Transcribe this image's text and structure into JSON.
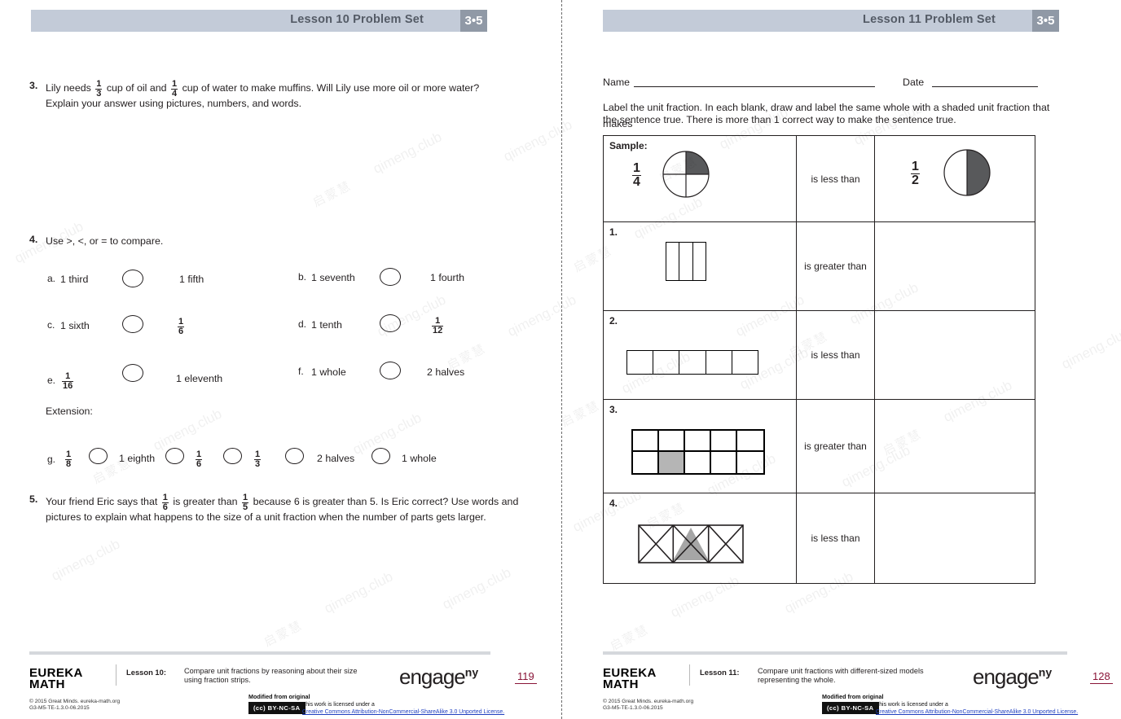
{
  "watermark": {
    "text_latin": "qimeng.club",
    "text_cjk": "启蒙慧"
  },
  "left_page": {
    "header": {
      "title": "Lesson 10 Problem Set",
      "badge": "3•5"
    },
    "problem3": {
      "number": "3.",
      "line1_a": "Lily needs",
      "frac1": {
        "n": "1",
        "d": "3"
      },
      "line1_b": "cup of oil and",
      "frac2": {
        "n": "1",
        "d": "4"
      },
      "line1_c": "cup of water to make muffins.  Will Lily use more oil or more water?",
      "line2": "Explain your answer using pictures, numbers, and words."
    },
    "problem4": {
      "number": "4.",
      "prompt": "Use >, <, or = to compare.",
      "items": [
        {
          "letter": "a.",
          "left": "1 third",
          "right": "1 fifth"
        },
        {
          "letter": "b.",
          "left": "1 seventh",
          "right": "1 fourth"
        },
        {
          "letter": "c.",
          "left": "1 sixth",
          "right_frac": {
            "n": "1",
            "d": "6"
          }
        },
        {
          "letter": "d.",
          "left": "1 tenth",
          "right_frac": {
            "n": "1",
            "d": "12"
          }
        },
        {
          "letter": "e.",
          "left_frac": {
            "n": "1",
            "d": "16"
          },
          "right": "1 eleventh"
        },
        {
          "letter": "f.",
          "left": "1 whole",
          "right": "2 halves"
        }
      ],
      "extension_label": "Extension:",
      "extension": {
        "letter": "g.",
        "terms": [
          {
            "frac": {
              "n": "1",
              "d": "8"
            }
          },
          {
            "text": "1 eighth"
          },
          {
            "frac": {
              "n": "1",
              "d": "6"
            }
          },
          {
            "frac": {
              "n": "1",
              "d": "3"
            }
          },
          {
            "text": "2 halves"
          },
          {
            "text": "1 whole"
          }
        ]
      }
    },
    "problem5": {
      "number": "5.",
      "line1_a": "Your friend Eric says that",
      "frac1": {
        "n": "1",
        "d": "6"
      },
      "line1_b": "is greater than",
      "frac2": {
        "n": "1",
        "d": "5"
      },
      "line1_c": "because 6 is greater than 5.  Is Eric correct?  Use words and",
      "line2": "pictures to explain what happens to the size of a unit fraction when the number of parts gets larger."
    },
    "footer": {
      "brand_line1": "EUREKA",
      "brand_line2": "MATH",
      "lesson_label": "Lesson 10:",
      "lesson_desc": "Compare unit fractions by reasoning about their size using fraction strips.",
      "engage": "engage",
      "engage_sup": "ny",
      "page_number": "119",
      "copyright_line1": "© 2015 Great Minds. eureka-math.org",
      "copyright_line2": "G3-M5-TE-1.3.0-06.2015",
      "modified": "Modified from original",
      "cc_badge": "BY-NC-SA",
      "cc_line1": "This work is licensed under a",
      "cc_line2": "Creative Commons Attribution-NonCommercial-ShareAlike 3.0 Unported License."
    }
  },
  "right_page": {
    "header": {
      "title": "Lesson 11 Problem Set",
      "badge": "3•5"
    },
    "name_label": "Name",
    "date_label": "Date",
    "directions_line1": "Label the unit fraction.  In each blank, draw and label the same whole with a shaded unit fraction that makes",
    "directions_line2": "the sentence true.  There is more than 1 correct way to make the sentence true.",
    "table": {
      "rows": [
        {
          "label": "Sample:",
          "left_frac": {
            "n": "1",
            "d": "4"
          },
          "left_shape": "circle-quarter",
          "middle": "is less than",
          "right_frac": {
            "n": "1",
            "d": "2"
          },
          "right_shape": "circle-half"
        },
        {
          "label": "1.",
          "left_shape": "vertical-strip-3",
          "middle": "is greater than",
          "right_shape": "blank"
        },
        {
          "label": "2.",
          "left_shape": "horizontal-strip-5",
          "middle": "is less than",
          "right_shape": "blank"
        },
        {
          "label": "3.",
          "left_shape": "grid-5x2",
          "middle": "is greater than",
          "right_shape": "blank"
        },
        {
          "label": "4.",
          "left_shape": "triangles-3-squares",
          "middle": "is less than",
          "right_shape": "blank"
        }
      ]
    },
    "footer": {
      "brand_line1": "EUREKA",
      "brand_line2": "MATH",
      "lesson_label": "Lesson 11:",
      "lesson_desc": "Compare unit fractions with different-sized models representing the whole.",
      "engage": "engage",
      "engage_sup": "ny",
      "page_number": "128",
      "copyright_line1": "© 2015 Great Minds. eureka-math.org",
      "copyright_line2": "G3-M5-TE-1.3.0-06.2015",
      "modified": "Modified from original",
      "cc_badge": "BY-NC-SA",
      "cc_line1": "This work is licensed under a",
      "cc_line2": "Creative Commons Attribution-NonCommercial-ShareAlike 3.0 Unported License."
    }
  }
}
